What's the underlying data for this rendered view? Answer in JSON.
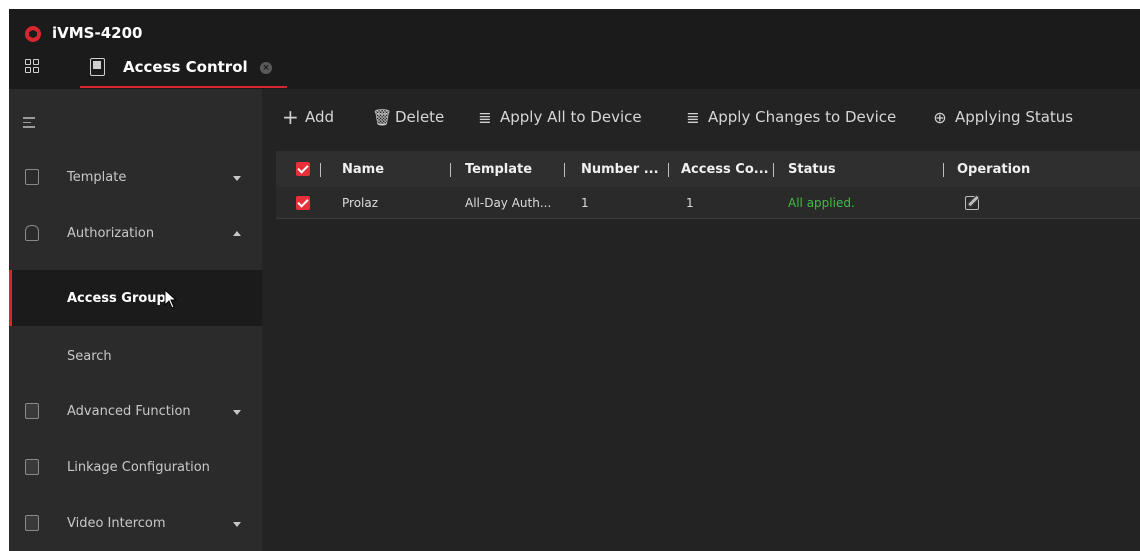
{
  "app": {
    "title": "iVMS-4200"
  },
  "tab": {
    "label": "Access Control"
  },
  "sidebar": {
    "items": [
      {
        "label": "Template"
      },
      {
        "label": "Authorization"
      },
      {
        "label": "Access Group"
      },
      {
        "label": "Search"
      },
      {
        "label": "Advanced Function"
      },
      {
        "label": "Linkage Configuration"
      },
      {
        "label": "Video Intercom"
      }
    ]
  },
  "toolbar": {
    "add": "Add",
    "delete": "Delete",
    "apply_all": "Apply All to Device",
    "apply_changes": "Apply Changes to Device",
    "applying_status": "Applying Status"
  },
  "table": {
    "headers": [
      "Name",
      "Template",
      "Number ...",
      "Access Co...",
      "Status",
      "Operation"
    ],
    "rows": [
      {
        "name": "Prolaz",
        "template": "All-Day Auth...",
        "number": "1",
        "access_co": "1",
        "status": "All applied."
      }
    ]
  },
  "colors": {
    "accent": "#d7262e",
    "status_ok": "#3fbf3f",
    "background": "#232323"
  }
}
